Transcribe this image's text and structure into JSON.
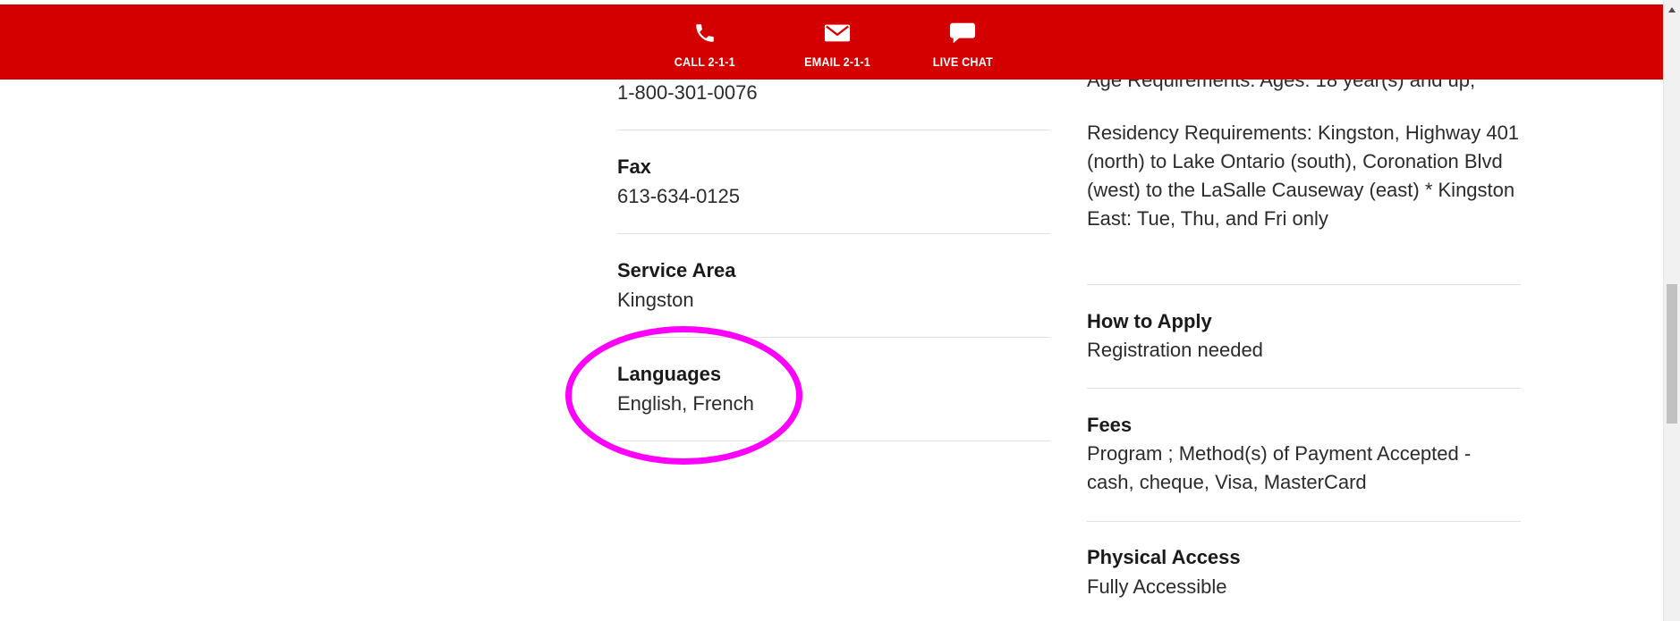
{
  "contact_bar": {
    "call_label": "CALL 2-1-1",
    "email_label": "EMAIL 2-1-1",
    "chat_label": "LIVE CHAT",
    "background_color": "#d40000",
    "icons": [
      "phone-icon",
      "envelope-icon",
      "chat-bubble-icon"
    ]
  },
  "left_column": {
    "toll_free_value": "1-800-301-0076",
    "fax": {
      "label": "Fax",
      "value": "613-634-0125"
    },
    "service_area": {
      "label": "Service Area",
      "value": "Kingston"
    },
    "languages": {
      "label": "Languages",
      "value": "English, French"
    }
  },
  "right_column": {
    "age_requirement_partial": "Age Requirements: Ages: 18 year(s) and up;",
    "residency": "Residency Requirements: Kingston, Highway 401 (north) to Lake Ontario (south), Coronation Blvd (west) to the LaSalle Causeway (east) * Kingston East: Tue, Thu, and Fri only",
    "how_to_apply": {
      "label": "How to Apply",
      "value": "Registration needed"
    },
    "fees": {
      "label": "Fees",
      "value": "Program ; Method(s) of Payment Accepted - cash, cheque, Visa, MasterCard"
    },
    "physical_access": {
      "label": "Physical Access",
      "value": "Fully Accessible"
    }
  },
  "annotation": {
    "highlight_color": "#ff00ff"
  }
}
